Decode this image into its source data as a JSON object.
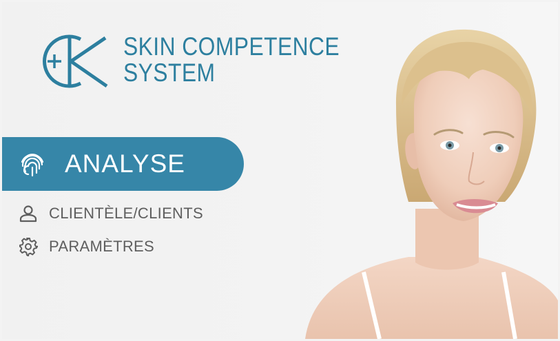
{
  "brand": {
    "logo_icon": "ck-monogram-logo",
    "logo_text": "+K",
    "name_line1": "SKIN COMPETENCE",
    "name_line2": "SYSTEM",
    "color": "#2d7f9f"
  },
  "nav": {
    "active": {
      "label": "ANALYSE",
      "icon": "fingerprint-icon",
      "background": "#3686a8"
    },
    "items": [
      {
        "label": "CLIENTÈLE/CLIENTS",
        "icon": "user-icon"
      },
      {
        "label": "PARAMÈTRES",
        "icon": "gear-icon"
      }
    ]
  },
  "hero": {
    "image": "woman-portrait"
  }
}
